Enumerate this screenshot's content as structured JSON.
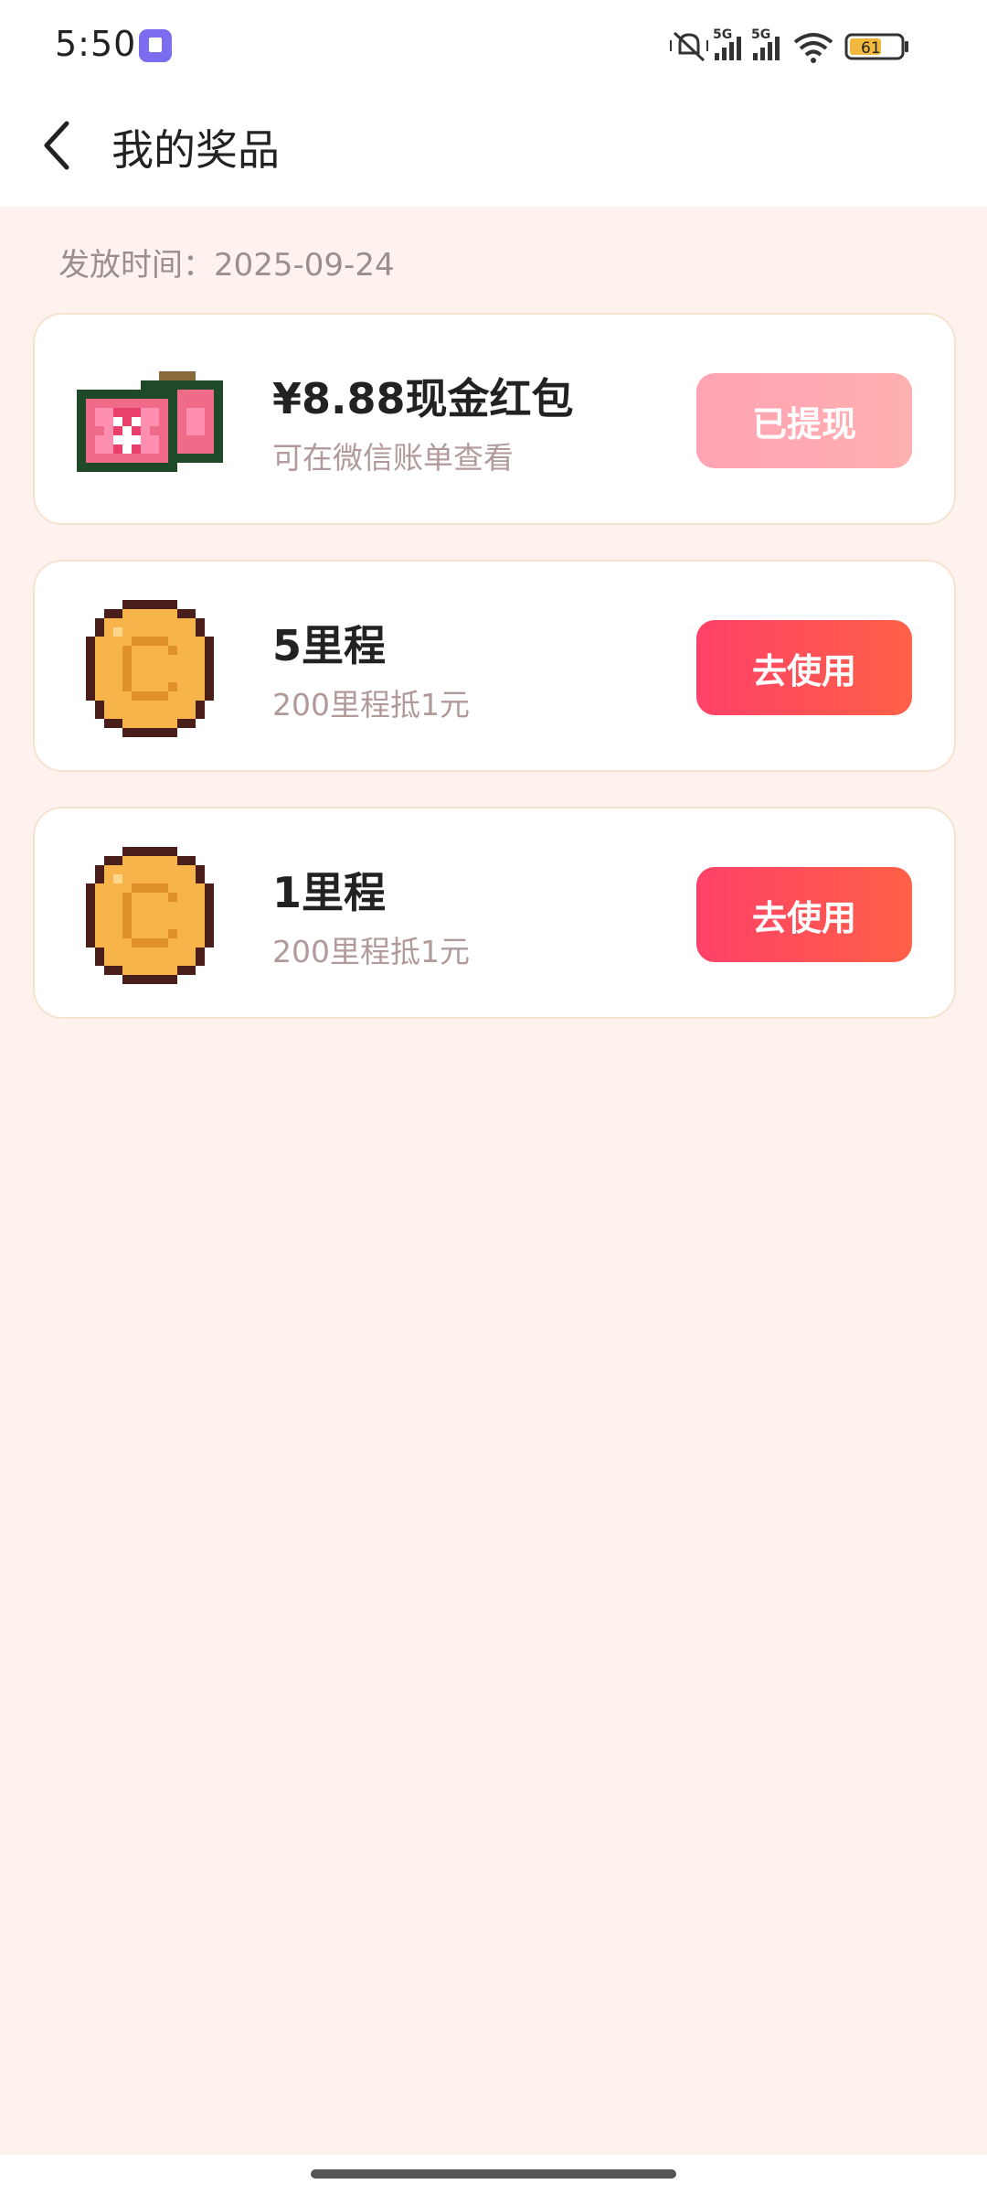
{
  "status_bar": {
    "time": "5:50",
    "network_1": "5G",
    "network_2": "5G",
    "battery": "61",
    "icons": [
      "app-icon",
      "mute-icon",
      "signal-icon",
      "signal-icon",
      "wifi-icon",
      "battery-icon"
    ]
  },
  "header": {
    "back_icon": "chevron-left-icon",
    "title": "我的奖品"
  },
  "date_label": "发放时间：2025-09-24",
  "prizes": [
    {
      "icon": "cash-red-envelope-icon",
      "title": "¥8.88现金红包",
      "subtitle": "可在微信账单查看",
      "button": "已提现",
      "button_state": "disabled"
    },
    {
      "icon": "gold-coin-icon",
      "title": "5里程",
      "subtitle": "200里程抵1元",
      "button": "去使用",
      "button_state": "active"
    },
    {
      "icon": "gold-coin-icon",
      "title": "1里程",
      "subtitle": "200里程抵1元",
      "button": "去使用",
      "button_state": "active"
    }
  ],
  "colors": {
    "background": "#fdf2ee",
    "button_active": "#ff4b5c",
    "button_disabled": "#ffa8b4",
    "subtitle": "#b29a9a"
  }
}
